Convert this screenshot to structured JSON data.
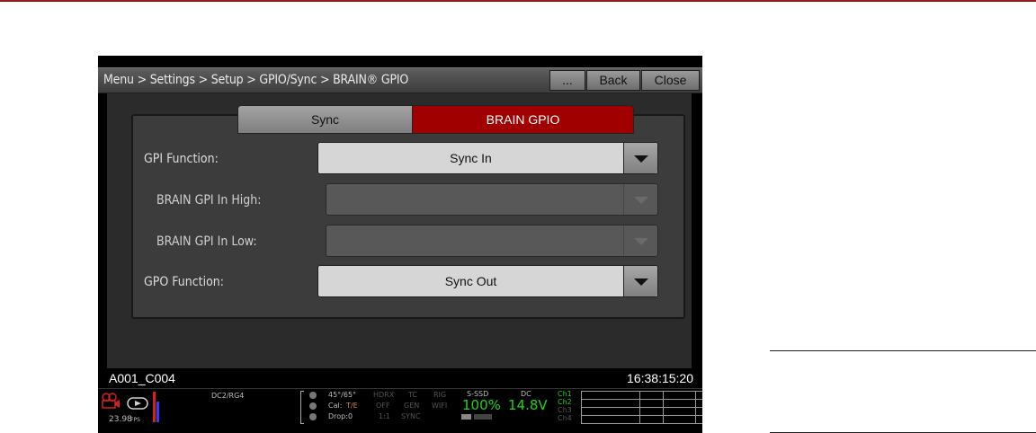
{
  "breadcrumb": "Menu > Settings > Setup > GPIO/Sync > BRAIN® GPIO",
  "buttons": {
    "more": "...",
    "back": "Back",
    "close": "Close"
  },
  "tabs": {
    "sync": "Sync",
    "brain_gpio": "BRAIN GPIO"
  },
  "fields": {
    "gpi_function": {
      "label": "GPI Function:",
      "value": "Sync In"
    },
    "gpi_in_high": {
      "label": "BRAIN GPI In High:",
      "value": ""
    },
    "gpi_in_low": {
      "label": "BRAIN GPI In Low:",
      "value": ""
    },
    "gpo_function": {
      "label": "GPO Function:",
      "value": "Sync Out"
    }
  },
  "clip_name": "A001_C004",
  "timecode": "16:38:15:20",
  "status": {
    "fps": "23.98",
    "fps_unit": "FPS",
    "color": "DC2/RG4",
    "temp": "45°/65°",
    "cal_label": "Cal:",
    "cal_value": "T/E",
    "drop": "Drop:0",
    "hdrx_label": "HDRX",
    "hdrx_value": "OFF",
    "hdrx_ratio": "1:1",
    "tc_label": "TC",
    "tc_value": "GEN",
    "tc_mode": "SYNC",
    "rig_label": "RIG",
    "rig_value": "WIFI",
    "media_label": "S-SSD",
    "media_value": "100%",
    "power_label": "DC",
    "power_value": "14.8V",
    "channels": [
      "Ch1",
      "Ch2",
      "Ch3",
      "Ch4"
    ],
    "accent_green": "#22d022",
    "accent_red": "#a00000"
  }
}
